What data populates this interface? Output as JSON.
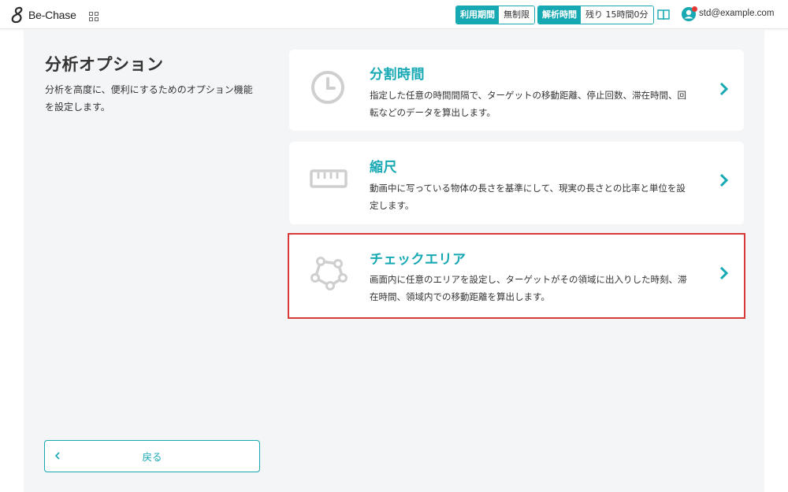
{
  "header": {
    "app_name": "Be-Chase",
    "usage_period_label": "利用期間",
    "usage_period_value": "無制限",
    "analysis_time_label": "解析時間",
    "analysis_time_value": "残り 15時間0分",
    "user_email": "std@example.com",
    "notification_color": "#e53935"
  },
  "sidebar": {
    "title": "分析オプション",
    "description": "分析を高度に、便利にするためのオプション機能を設定します。",
    "back_label": "戻る"
  },
  "options": [
    {
      "icon": "clock-icon",
      "title": "分割時間",
      "description": "指定した任意の時間間隔で、ターゲットの移動距離、停止回数、滞在時間、回転などのデータを算出します。"
    },
    {
      "icon": "ruler-icon",
      "title": "縮尺",
      "description": "動画中に写っている物体の長さを基準にして、現実の長さとの比率と単位を設定します。"
    },
    {
      "icon": "polygon-area-icon",
      "title": "チェックエリア",
      "description": "画面内に任意のエリアを設定し、ターゲットがその領域に出入りした時刻、滞在時間、領域内での移動距離を算出します。"
    }
  ],
  "colors": {
    "accent": "#17a9b3",
    "highlight": "#d83a3a",
    "background": "#f4f5f7"
  }
}
